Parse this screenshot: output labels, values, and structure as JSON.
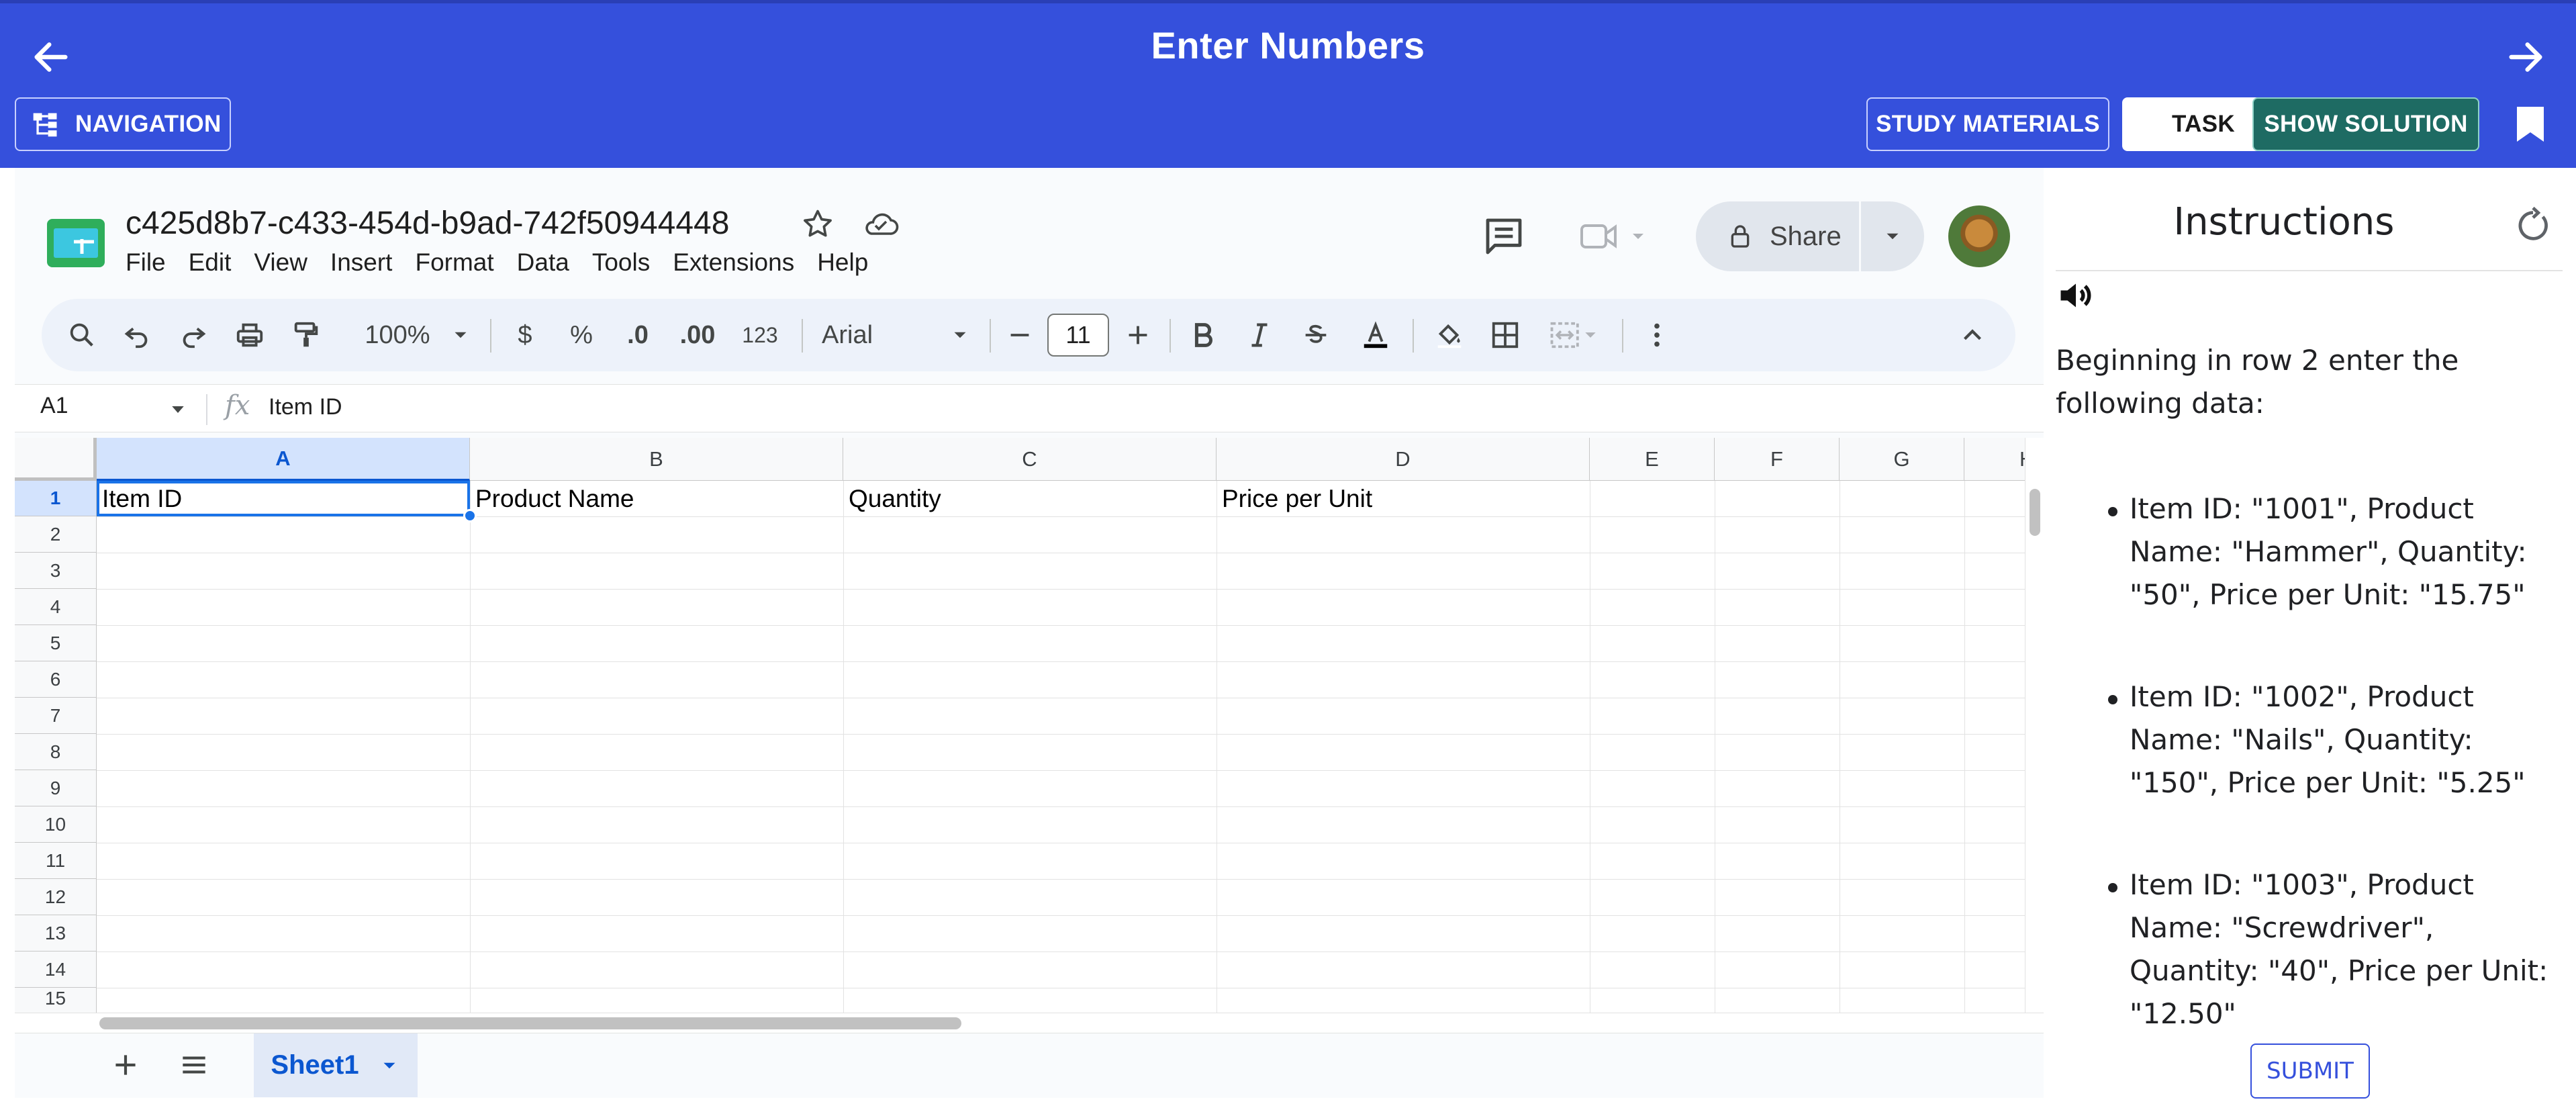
{
  "app": {
    "title": "Enter Numbers",
    "nav_label": "NAVIGATION",
    "study_label": "STUDY MATERIALS",
    "task_label": "TASK",
    "solution_label": "SHOW SOLUTION"
  },
  "sheet": {
    "doc_title": "c425d8b7-c433-454d-b9ad-742f50944448",
    "menu": [
      "File",
      "Edit",
      "View",
      "Insert",
      "Format",
      "Data",
      "Tools",
      "Extensions",
      "Help"
    ],
    "share_label": "Share",
    "toolbar": {
      "zoom": "100%",
      "currency": "$",
      "percent": "%",
      "dec_less": ".0",
      "dec_more": ".00",
      "number_format": "123",
      "font": "Arial",
      "font_size": "11"
    },
    "name_box": "A1",
    "formula_value": "Item ID",
    "columns": [
      "A",
      "B",
      "C",
      "D",
      "E",
      "F",
      "G",
      "H"
    ],
    "rows": [
      "1",
      "2",
      "3",
      "4",
      "5",
      "6",
      "7",
      "8",
      "9",
      "10",
      "11",
      "12",
      "13",
      "14",
      "15"
    ],
    "cells": {
      "A1": "Item ID",
      "B1": "Product Name",
      "C1": "Quantity",
      "D1": "Price per Unit"
    },
    "tab_name": "Sheet1"
  },
  "instructions": {
    "title": "Instructions",
    "intro": "Beginning in row 2  enter the following data:",
    "items": [
      "Item ID: \"1001\", Product Name: \"Hammer\", Quantity: \"50\", Price per Unit: \"15.75\"",
      "Item ID: \"1002\", Product Name: \"Nails\", Quantity: \"150\", Price per Unit: \"5.25\"",
      "Item ID: \"1003\", Product Name: \"Screwdriver\", Quantity: \"40\", Price per Unit: \"12.50\""
    ],
    "submit_label": "SUBMIT"
  },
  "colors": {
    "brand": "#3550dc",
    "solution": "#1e6b63",
    "selection": "#1a73e8"
  }
}
